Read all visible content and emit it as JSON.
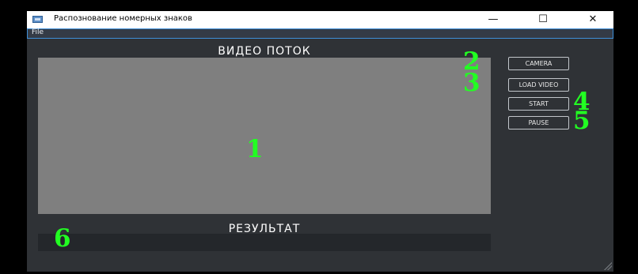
{
  "window": {
    "title": "Распознование номерных знаков",
    "minimize_glyph": "—",
    "maximize_glyph": "☐",
    "close_glyph": "✕"
  },
  "menu": {
    "file_label": "File"
  },
  "video": {
    "title": "ВИДЕО ПОТОК"
  },
  "result": {
    "title": "РЕЗУЛЬТАТ",
    "value": ""
  },
  "buttons": {
    "camera": "CAMERA",
    "load_video": "LOAD VIDEO",
    "start": "START",
    "pause": "PAUSE"
  },
  "markers": {
    "video": "1",
    "camera": "2",
    "load_video": "3",
    "start": "4",
    "pause": "5",
    "result": "6"
  },
  "colors": {
    "window_bg": "#2f3236",
    "video_bg": "#7f7f7f",
    "result_bg": "#24272b",
    "marker": "#22ff22",
    "menubar_border": "#3f8fd8"
  }
}
